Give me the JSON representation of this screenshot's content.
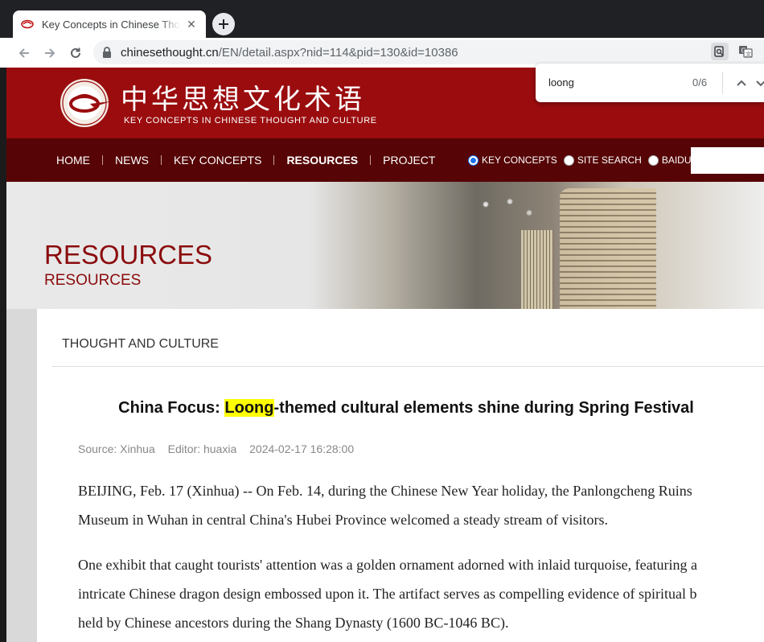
{
  "browser": {
    "tab_title": "Key Concepts in Chinese Thought and Culture",
    "tab_close": "✕",
    "url_host": "chinesethought.cn",
    "url_path": "/EN/detail.aspx?nid=114&pid=130&id=10386"
  },
  "find": {
    "query": "loong",
    "count": "0/6"
  },
  "site": {
    "title_cn": "中华思想文化术语",
    "title_en": "KEY CONCEPTS IN CHINESE THOUGHT AND CULTURE",
    "brand_color": "#9a0c0e",
    "nav_color": "#560405"
  },
  "nav": {
    "items": [
      "HOME",
      "NEWS",
      "KEY CONCEPTS",
      "RESOURCES",
      "PROJECT"
    ],
    "active": "RESOURCES"
  },
  "search": {
    "options": [
      "KEY CONCEPTS",
      "SITE SEARCH",
      "BAIDU"
    ],
    "selected": "KEY CONCEPTS"
  },
  "banner": {
    "title": "RESOURCES",
    "subtitle": "RESOURCES"
  },
  "section": {
    "label": "THOUGHT AND CULTURE"
  },
  "article": {
    "title_prefix": "China Focus: ",
    "title_highlight": "Loong",
    "title_suffix": "-themed cultural elements shine during Spring Festival",
    "source": "Source: Xinhua",
    "editor": "Editor: huaxia",
    "date": "2024-02-17 16:28:00",
    "lines": [
      "BEIJING, Feb. 17 (Xinhua) -- On Feb. 14, during the Chinese New Year holiday, the Panlongcheng Ruins",
      "Museum in Wuhan in central China's Hubei Province welcomed a steady stream of visitors.",
      "One exhibit that caught tourists' attention was a golden ornament adorned with inlaid turquoise, featuring a",
      "intricate Chinese dragon design embossed upon it. The artifact serves as compelling evidence of spiritual b",
      "held by Chinese ancestors during the Shang Dynasty (1600 BC-1046 BC)."
    ]
  }
}
